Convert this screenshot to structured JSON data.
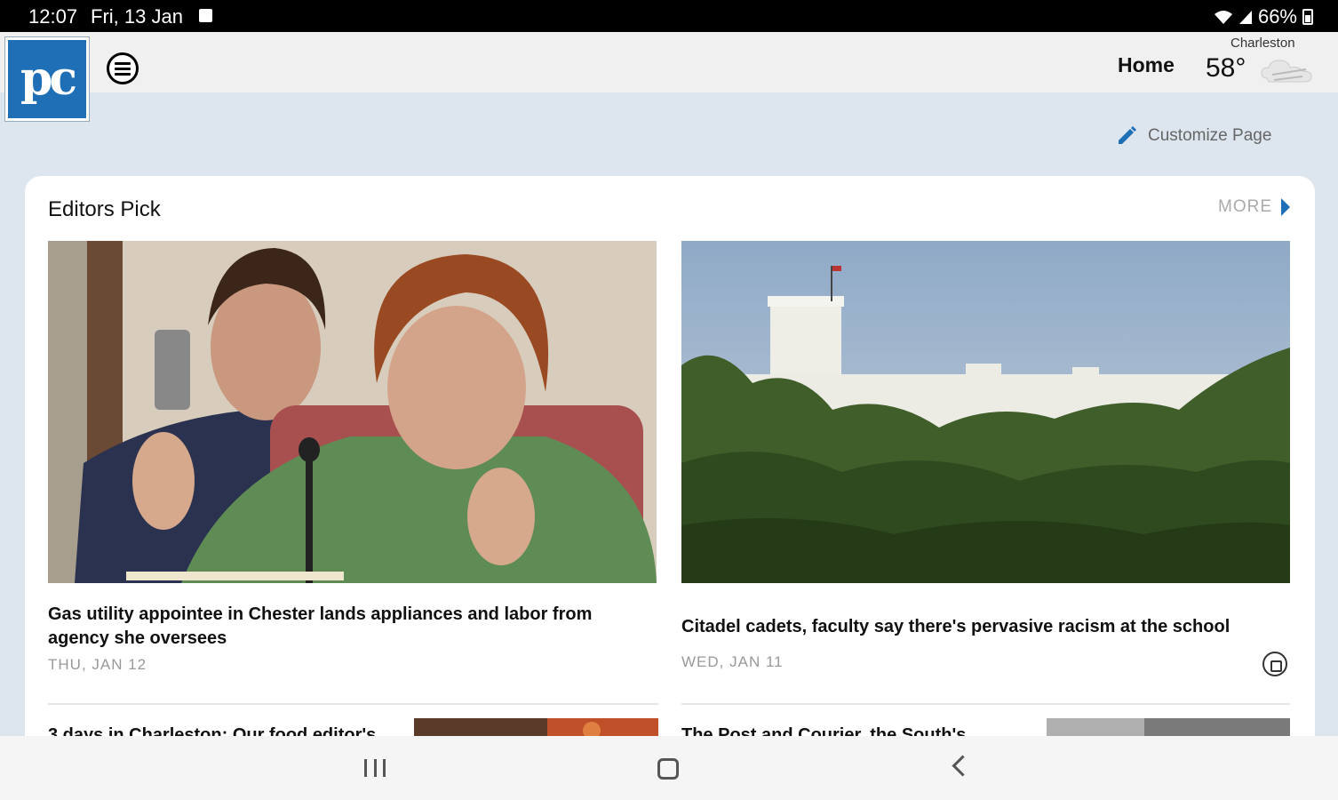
{
  "status_bar": {
    "time": "12:07",
    "date": "Fri, 13 Jan",
    "battery": "66%"
  },
  "header": {
    "logo_text": "pc",
    "nav_home": "Home",
    "weather": {
      "city": "Charleston",
      "temp": "58°"
    }
  },
  "toolbar": {
    "customize_label": "Customize Page"
  },
  "section": {
    "title": "Editors Pick",
    "more_label": "MORE",
    "stories": [
      {
        "headline": "Gas utility appointee in Chester lands appliances and labor from agency she oversees",
        "date": "THU, JAN 12"
      },
      {
        "headline": "Citadel cadets, faculty say there's pervasive racism at the school",
        "date": "WED, JAN 11"
      }
    ],
    "next_stories": [
      {
        "headline": "3 days in Charleston: Our food editor's"
      },
      {
        "headline": "The Post and Courier, the South's"
      }
    ]
  },
  "colors": {
    "accent": "#1e6fb5",
    "background": "#dde6ee"
  }
}
